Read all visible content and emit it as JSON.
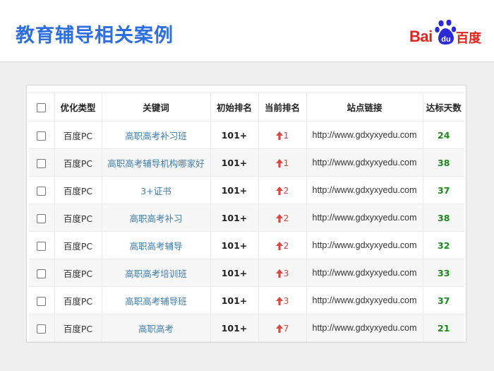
{
  "page": {
    "title": "教育辅导相关案例"
  },
  "logo": {
    "text_latin": "Bai",
    "text_paw": "du",
    "text_cn": "百度"
  },
  "table": {
    "headers": {
      "select": "",
      "type": "优化类型",
      "keyword": "关键词",
      "initial_rank": "初始排名",
      "current_rank": "当前排名",
      "site_link": "站点链接",
      "days": "达标天数"
    },
    "rows": [
      {
        "type": "百度PC",
        "keyword": "高职高考补习班",
        "initial_rank": "101+",
        "current_rank": "1",
        "site_link": "http://www.gdxyxyedu.com",
        "days": "24"
      },
      {
        "type": "百度PC",
        "keyword": "高职高考辅导机构哪家好",
        "initial_rank": "101+",
        "current_rank": "1",
        "site_link": "http://www.gdxyxyedu.com",
        "days": "38"
      },
      {
        "type": "百度PC",
        "keyword": "3+证书",
        "initial_rank": "101+",
        "current_rank": "2",
        "site_link": "http://www.gdxyxyedu.com",
        "days": "37"
      },
      {
        "type": "百度PC",
        "keyword": "高职高考补习",
        "initial_rank": "101+",
        "current_rank": "2",
        "site_link": "http://www.gdxyxyedu.com",
        "days": "38"
      },
      {
        "type": "百度PC",
        "keyword": "高职高考辅导",
        "initial_rank": "101+",
        "current_rank": "2",
        "site_link": "http://www.gdxyxyedu.com",
        "days": "32"
      },
      {
        "type": "百度PC",
        "keyword": "高职高考培训班",
        "initial_rank": "101+",
        "current_rank": "3",
        "site_link": "http://www.gdxyxyedu.com",
        "days": "33"
      },
      {
        "type": "百度PC",
        "keyword": "高职高考辅导班",
        "initial_rank": "101+",
        "current_rank": "3",
        "site_link": "http://www.gdxyxyedu.com",
        "days": "37"
      },
      {
        "type": "百度PC",
        "keyword": "高职高考",
        "initial_rank": "101+",
        "current_rank": "7",
        "site_link": "http://www.gdxyxyedu.com",
        "days": "21"
      }
    ]
  },
  "colors": {
    "title": "#2d6fe0",
    "brand_red": "#e1251b",
    "brand_blue": "#2a2ad8",
    "keyword": "#3f7dab",
    "rank_up": "#e0463b",
    "days": "#1a8a1a"
  },
  "icons": {
    "rank_change": "arrow-up-icon",
    "logo": "baidu-paw-icon"
  }
}
